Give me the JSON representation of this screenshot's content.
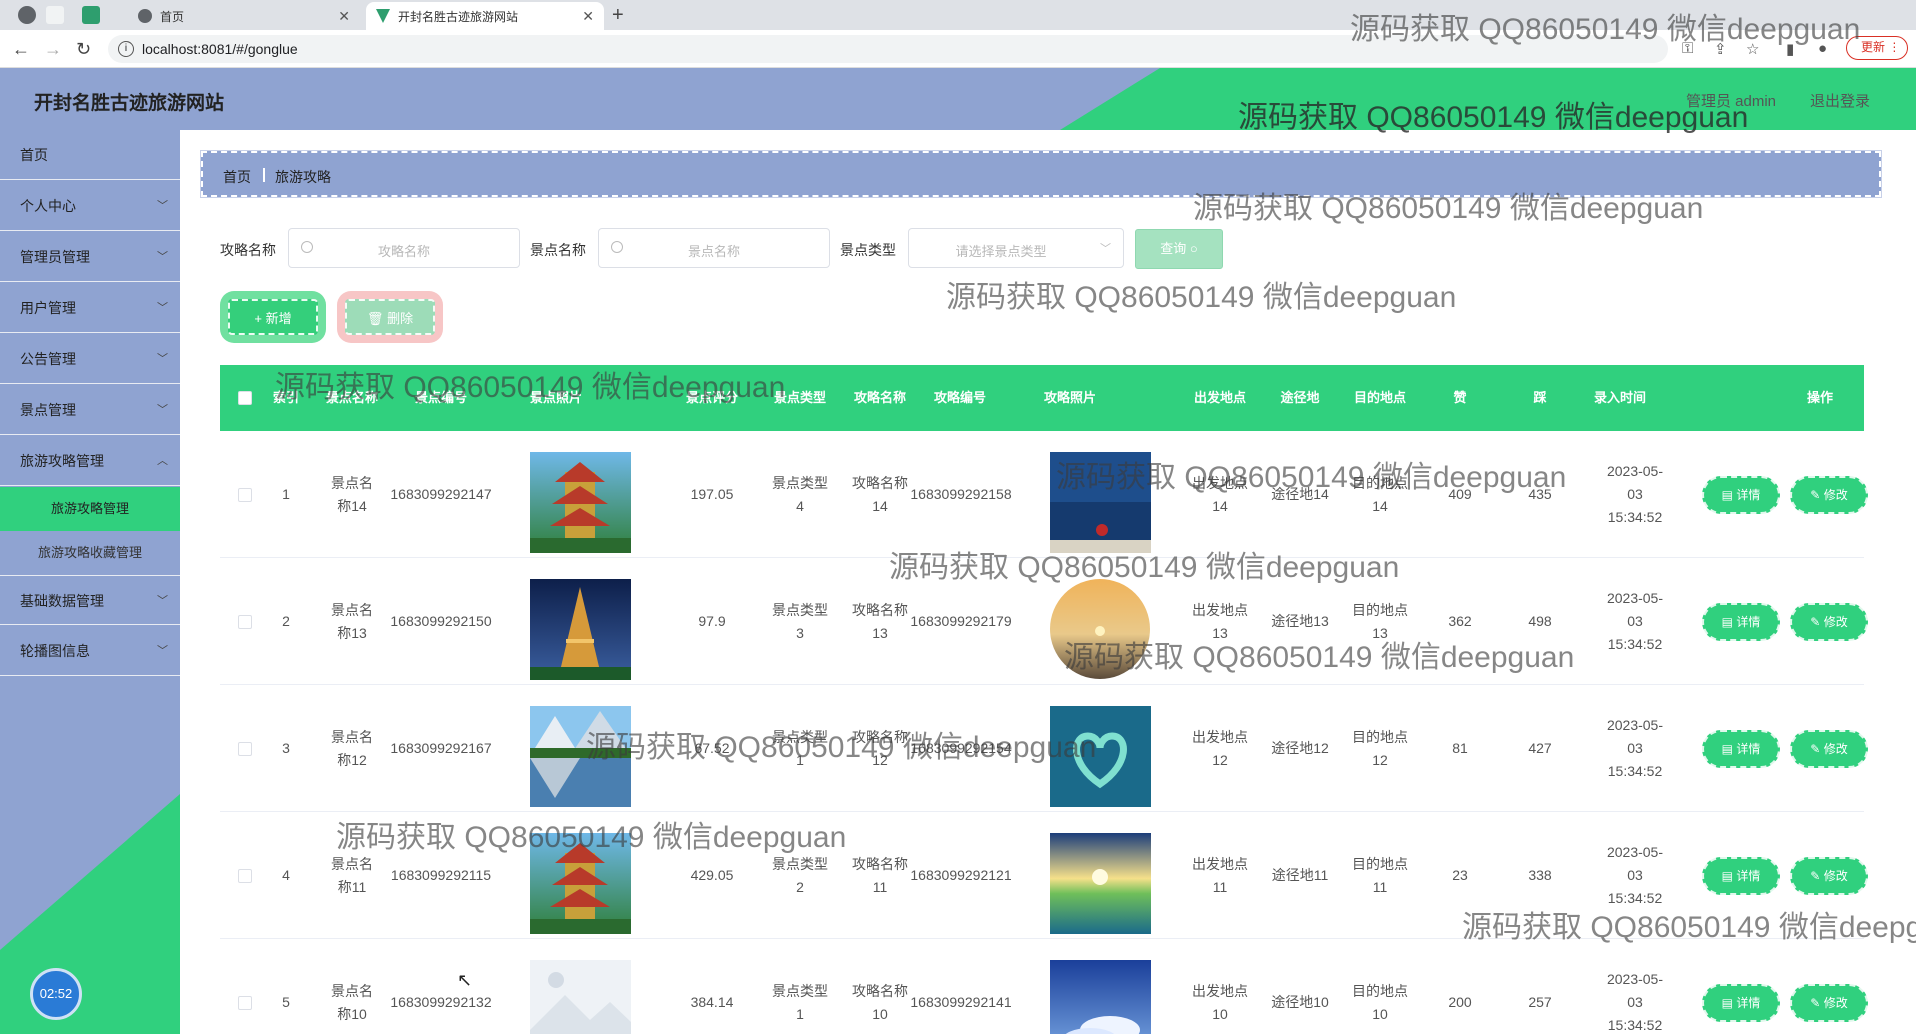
{
  "browser": {
    "tabs": [
      {
        "title": "首页"
      },
      {
        "title": "开封名胜古迹旅游网站"
      }
    ],
    "url": "localhost:8081/#/gonglue",
    "update_label": "更新"
  },
  "header": {
    "site_title": "开封名胜古迹旅游网站",
    "user_label": "管理员 admin",
    "logout_label": "退出登录"
  },
  "sidebar": {
    "items": [
      {
        "label": "首页"
      },
      {
        "label": "个人中心"
      },
      {
        "label": "管理员管理"
      },
      {
        "label": "用户管理"
      },
      {
        "label": "公告管理"
      },
      {
        "label": "景点管理"
      },
      {
        "label": "旅游攻略管理"
      },
      {
        "label": "基础数据管理"
      },
      {
        "label": "轮播图信息"
      }
    ],
    "subitems": [
      {
        "label": "旅游攻略管理"
      },
      {
        "label": "旅游攻略收藏管理"
      }
    ],
    "clock": "02:52"
  },
  "breadcrumb": {
    "home": "首页",
    "current": "旅游攻略"
  },
  "filters": {
    "strategy_name_label": "攻略名称",
    "strategy_name_placeholder": "攻略名称",
    "spot_name_label": "景点名称",
    "spot_name_placeholder": "景点名称",
    "spot_type_label": "景点类型",
    "spot_type_placeholder": "请选择景点类型",
    "query_label": "查询"
  },
  "actions": {
    "add_label": "+ 新增",
    "delete_label": "删除"
  },
  "table": {
    "headers": [
      "索引",
      "景点名称",
      "景点编号",
      "景点照片",
      "景点评分",
      "景点类型",
      "攻略名称",
      "攻略编号",
      "攻略照片",
      "出发地点",
      "途径地",
      "目的地点",
      "赞",
      "踩",
      "录入时间",
      "操作"
    ],
    "detail_label": "详情",
    "edit_label": "修改",
    "rows": [
      {
        "index": "1",
        "spot_name": "景点名称14",
        "spot_no": "1683099292147",
        "score": "197.05",
        "spot_type": "景点类型4",
        "strategy_name": "攻略名称14",
        "strategy_no": "1683099292158",
        "start": "出发地点14",
        "via": "途径地14",
        "dest": "目的地点14",
        "likes": "409",
        "dislikes": "435",
        "time": "2023-05-03 15:34:52"
      },
      {
        "index": "2",
        "spot_name": "景点名称13",
        "spot_no": "1683099292150",
        "score": "97.9",
        "spot_type": "景点类型3",
        "strategy_name": "攻略名称13",
        "strategy_no": "1683099292179",
        "start": "出发地点13",
        "via": "途径地13",
        "dest": "目的地点13",
        "likes": "362",
        "dislikes": "498",
        "time": "2023-05-03 15:34:52"
      },
      {
        "index": "3",
        "spot_name": "景点名称12",
        "spot_no": "1683099292167",
        "score": "67.52",
        "spot_type": "景点类型1",
        "strategy_name": "攻略名称12",
        "strategy_no": "1683099292154",
        "start": "出发地点12",
        "via": "途径地12",
        "dest": "目的地点12",
        "likes": "81",
        "dislikes": "427",
        "time": "2023-05-03 15:34:52"
      },
      {
        "index": "4",
        "spot_name": "景点名称11",
        "spot_no": "1683099292115",
        "score": "429.05",
        "spot_type": "景点类型2",
        "strategy_name": "攻略名称11",
        "strategy_no": "1683099292121",
        "start": "出发地点11",
        "via": "途径地11",
        "dest": "目的地点11",
        "likes": "23",
        "dislikes": "338",
        "time": "2023-05-03 15:34:52"
      },
      {
        "index": "5",
        "spot_name": "景点名称10",
        "spot_no": "1683099292132",
        "score": "384.14",
        "spot_type": "景点类型1",
        "strategy_name": "攻略名称10",
        "strategy_no": "1683099292141",
        "start": "出发地点10",
        "via": "途径地10",
        "dest": "目的地点10",
        "likes": "200",
        "dislikes": "257",
        "time": "2023-05-03 15:34:52"
      }
    ]
  },
  "watermark_text": "源码获取 QQ86050149 微信deepguan",
  "colors": {
    "accent_green": "#30d07e",
    "sidebar_blue": "#8fa3d1"
  }
}
